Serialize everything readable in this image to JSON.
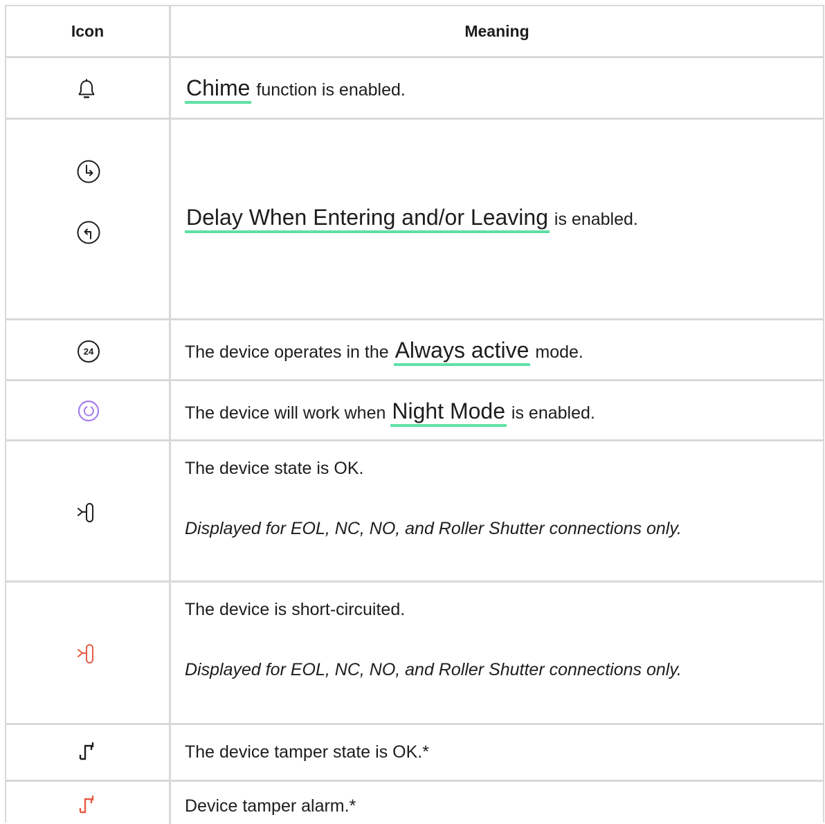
{
  "table": {
    "headers": {
      "icon": "Icon",
      "meaning": "Meaning"
    },
    "rows": [
      {
        "icons": [
          "bell-icon"
        ],
        "link": "Chime",
        "after": " function is enabled."
      },
      {
        "icons": [
          "delay-entering-icon",
          "delay-leaving-icon"
        ],
        "link": "Delay When Entering and/or Leaving",
        "after": " is enabled."
      },
      {
        "icons": [
          "always-active-24-icon"
        ],
        "before": "The device operates in the ",
        "link": "Always active",
        "after": " mode."
      },
      {
        "icons": [
          "night-mode-icon"
        ],
        "before": "The device will work when ",
        "link": "Night Mode",
        "after": " is enabled."
      },
      {
        "icons": [
          "connection-ok-icon"
        ],
        "text": "The device state is OK.",
        "note": "Displayed for EOL, NC, NO, and Roller Shutter connections only."
      },
      {
        "icons": [
          "short-circuit-icon"
        ],
        "text": "The device is short-circuited.",
        "note": "Displayed for EOL, NC, NO, and Roller Shutter connections only."
      },
      {
        "icons": [
          "tamper-ok-icon"
        ],
        "text": "The device tamper state is OK.*"
      },
      {
        "icons": [
          "tamper-alarm-icon"
        ],
        "text": "Device tamper alarm.*"
      }
    ]
  },
  "colors": {
    "border": "#d8d8d8",
    "link_underline": "#5ee0a6",
    "night_mode": "#a57ef0",
    "alarm": "#e55a45",
    "text": "#1d1d1d"
  }
}
